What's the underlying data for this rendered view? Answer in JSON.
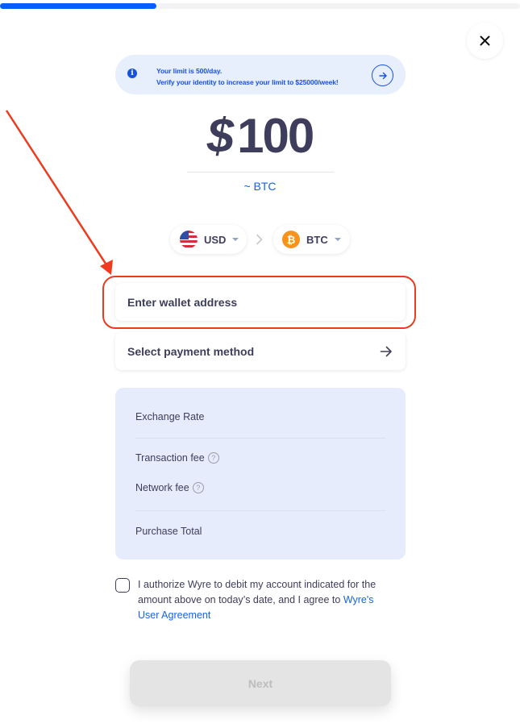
{
  "progress": {
    "fraction": 0.3
  },
  "close_label": "×",
  "banner": {
    "line1": "Your limit is 500/day.",
    "line2": "Verify your identity to increase your limit to $25000/week!",
    "info_icon": "i"
  },
  "amount": {
    "currency_symbol": "$",
    "value": "100"
  },
  "crypto_estimate": "~ BTC",
  "currency_from": {
    "code": "USD",
    "icon": "us-flag-icon"
  },
  "currency_to": {
    "code": "BTC",
    "icon": "bitcoin-icon",
    "symbol": "₿"
  },
  "wallet": {
    "placeholder": "Enter wallet address",
    "value": ""
  },
  "payment": {
    "label": "Select payment method"
  },
  "summary": {
    "exchange_rate_label": "Exchange Rate",
    "transaction_fee_label": "Transaction fee",
    "network_fee_label": "Network fee",
    "purchase_total_label": "Purchase Total",
    "help_glyph": "?"
  },
  "consent": {
    "text": "I authorize Wyre to debit my account indicated for the amount above on today’s date, and I agree to ",
    "link": "Wyre's User Agreement",
    "checked": false
  },
  "next_button": {
    "label": "Next",
    "disabled": true
  },
  "colors": {
    "accent": "#0b5cff",
    "link": "#1663e8",
    "text": "#3e3d5c",
    "annotation": "#ee3b1e",
    "summary_bg": "#e6ecfb"
  }
}
